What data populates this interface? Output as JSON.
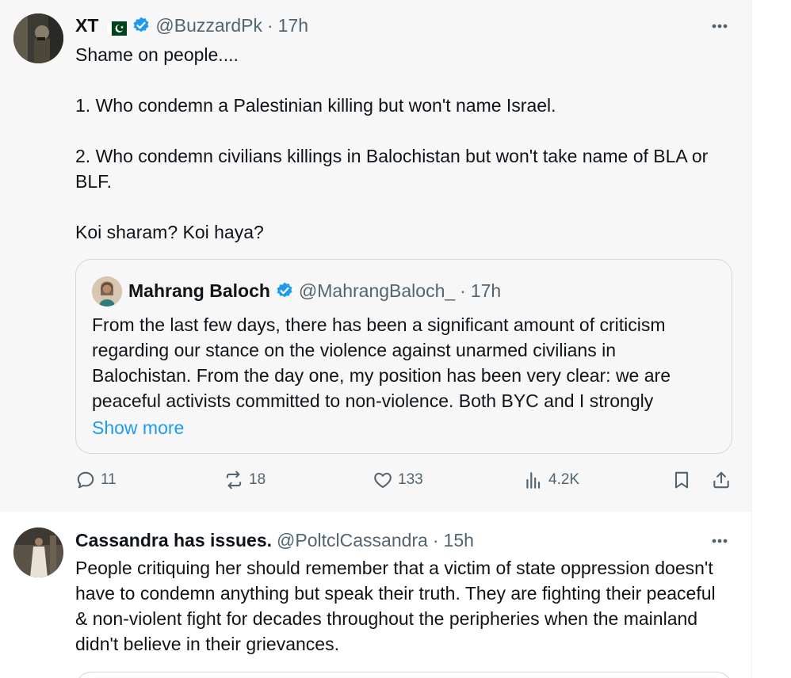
{
  "posts": [
    {
      "display_name": "XT",
      "handle": "@BuzzardPk",
      "separator": "·",
      "time": "17h",
      "text": "Shame on people....\n\n1. Who condemn a Palestinian killing but won't name Israel.\n\n2. Who condemn civilians killings in Balochistan but won't take name of BLA or BLF.\n\nKoi sharam? Koi haya?",
      "quote": {
        "display_name": "Mahrang Baloch",
        "handle": "@MahrangBaloch_",
        "separator": "·",
        "time": "17h",
        "text": "From the last few days, there has been a significant amount of criticism regarding our stance on the violence against unarmed civilians in Balochistan. From the day one, my position has been very clear: we are peaceful activists committed to non-violence. Both BYC and I strongly",
        "show_more": "Show more"
      },
      "stats": {
        "replies": "11",
        "reposts": "18",
        "likes": "133",
        "views": "4.2K"
      }
    },
    {
      "display_name": "Cassandra has issues.",
      "handle": "@PoltclCassandra",
      "separator": "·",
      "time": "15h",
      "text": "People critiquing her should remember that a victim of state oppression doesn't have to condemn anything but speak their truth. They are fighting their peaceful & non-violent fight for decades throughout the peripheries when the mainland didn't believe in their grievances."
    }
  ],
  "icons": {
    "more": "more-horizontal-icon",
    "reply": "reply-icon",
    "repost": "repost-icon",
    "like": "heart-icon",
    "views": "analytics-icon",
    "bookmark": "bookmark-icon",
    "share": "share-icon",
    "verified": "verified-badge-icon",
    "flag": "pakistan-flag-icon"
  },
  "colors": {
    "text_primary": "#0f1419",
    "text_secondary": "#536471",
    "link": "#1d9bf0",
    "verified": "#1d9bf0",
    "highlight_bg": "#f7f7f7",
    "border": "#cfd9de"
  }
}
